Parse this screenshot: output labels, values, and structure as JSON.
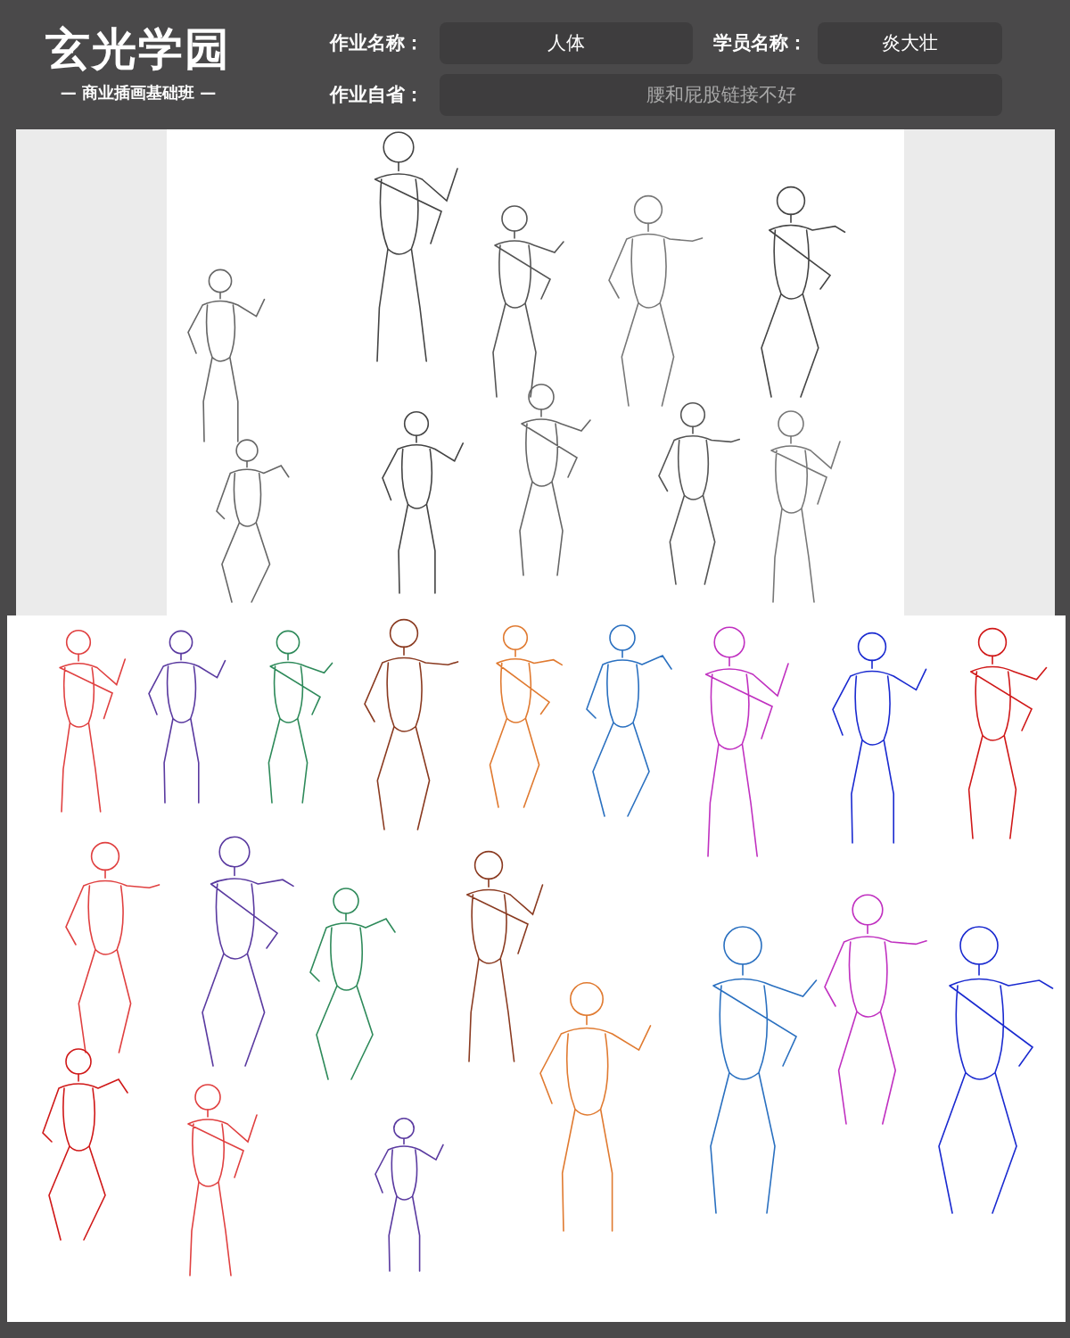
{
  "logo": {
    "title": "玄光学园",
    "subtitle": "— 商业插画基础班 —"
  },
  "fields": [
    {
      "label": "作业名称：",
      "value": "人体"
    },
    {
      "label": "学员名称：",
      "value": "炎大壮"
    },
    {
      "label": "作业自省：",
      "value": "腰和屁股链接不好"
    }
  ]
}
